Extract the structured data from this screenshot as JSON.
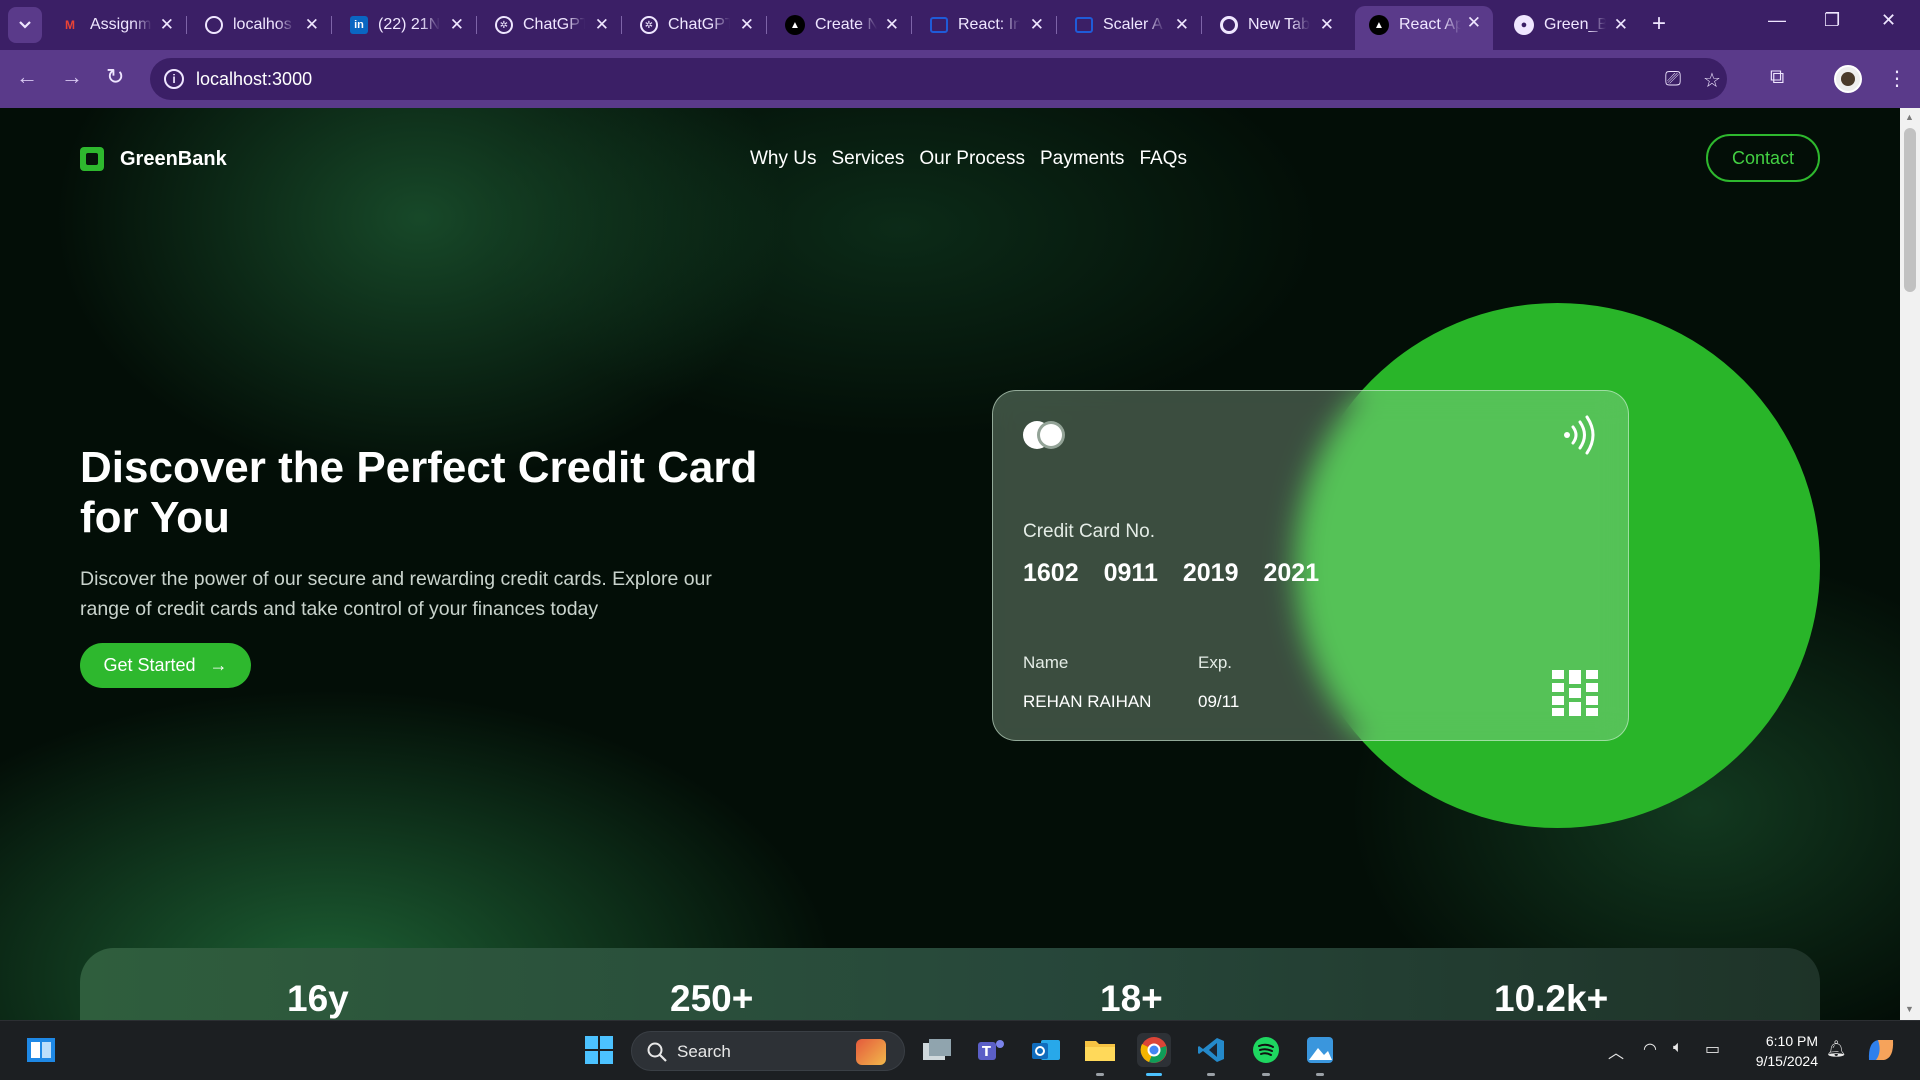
{
  "browser": {
    "tabs": [
      {
        "title": "Assignm",
        "icon": "gmail-icon",
        "color": "#ea4335"
      },
      {
        "title": "localhos",
        "icon": "globe-icon",
        "color": "#efe6ff"
      },
      {
        "title": "(22) 21N",
        "icon": "linkedin-icon",
        "color": "#0a66c2"
      },
      {
        "title": "ChatGPT",
        "icon": "chatgpt-icon",
        "color": "#efe6ff"
      },
      {
        "title": "ChatGPT",
        "icon": "chatgpt-icon",
        "color": "#efe6ff"
      },
      {
        "title": "Create N",
        "icon": "triangle-icon",
        "color": "#000000"
      },
      {
        "title": "React: In",
        "icon": "scaler-icon",
        "color": "#1f5bd8"
      },
      {
        "title": "Scaler A",
        "icon": "scaler-icon",
        "color": "#1f5bd8"
      },
      {
        "title": "New Tab",
        "icon": "chrome-icon",
        "color": "#efe6ff"
      },
      {
        "title": "React Ap",
        "icon": "triangle-icon",
        "color": "#000000",
        "active": true
      },
      {
        "title": "Green_B",
        "icon": "github-icon",
        "color": "#efe6ff"
      }
    ],
    "url": "localhost:3000"
  },
  "site": {
    "brand": "GreenBank",
    "nav": [
      "Why Us",
      "Services",
      "Our Process",
      "Payments",
      "FAQs"
    ],
    "contact_label": "Contact"
  },
  "hero": {
    "title": "Discover the Perfect Credit Card for You",
    "description": "Discover the power of our secure and rewarding credit cards. Explore our range of credit cards and take control of your finances today",
    "cta_label": "Get Started",
    "cta_arrow": "→"
  },
  "card": {
    "number_label": "Credit Card No.",
    "number_groups": [
      "1602",
      "0911",
      "2019",
      "2021"
    ],
    "name_label": "Name",
    "name_value": "REHAN RAIHAN",
    "exp_label": "Exp.",
    "exp_value": "09/11"
  },
  "stats": [
    "16y",
    "250+",
    "18+",
    "10.2k+"
  ],
  "taskbar": {
    "search_placeholder": "Search",
    "time": "6:10 PM",
    "date": "9/15/2024"
  },
  "colors": {
    "accent": "#2eb82e",
    "browser_frame": "#3b1f66",
    "browser_toolbar": "#5a3a8a",
    "page_bg": "#030e07"
  }
}
